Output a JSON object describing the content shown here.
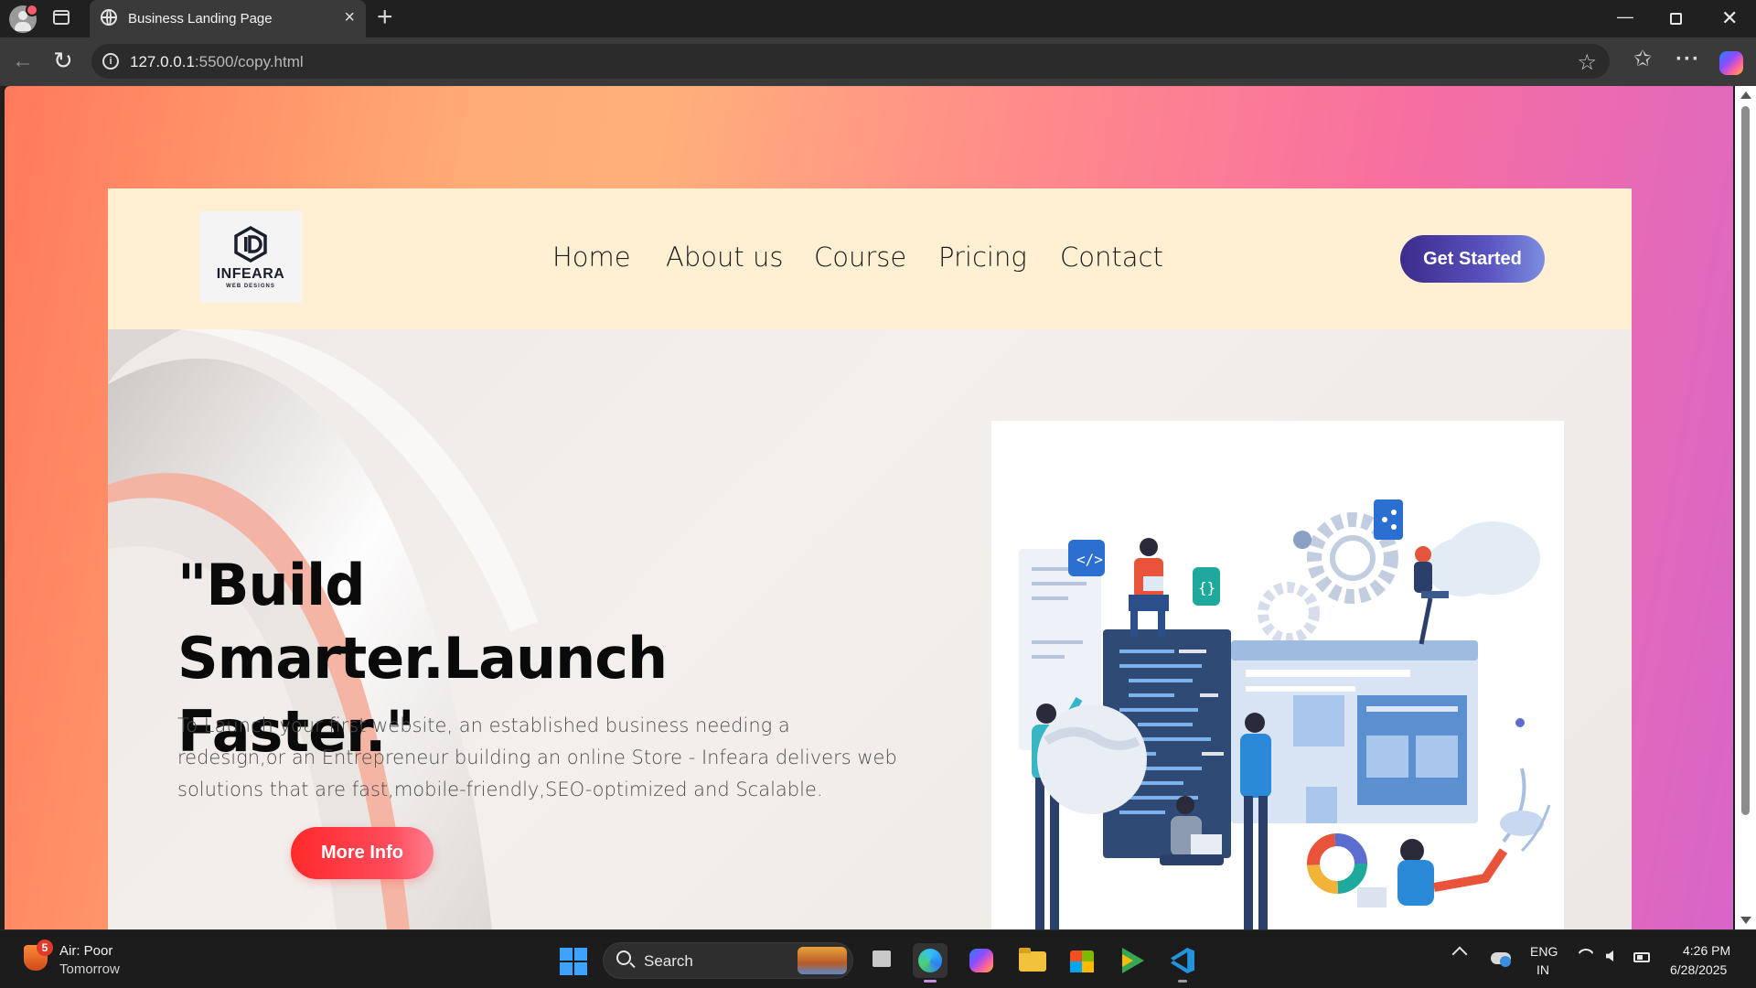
{
  "browser": {
    "tab_title": "Business Landing Page",
    "tab_close": "×",
    "new_tab": "+",
    "url_host": "127.0.0.1",
    "url_path": ":5500/copy.html",
    "back_glyph": "←",
    "reload_glyph": "↻",
    "star_glyph": "☆",
    "favorites_glyph": "✩",
    "more_glyph": "···",
    "minimize_glyph": "—",
    "close_glyph": "✕"
  },
  "site": {
    "logo_text": "INFEARA",
    "logo_sub": "WEB DESIGNS",
    "nav": [
      "Home",
      "About us",
      "Course",
      "Pricing",
      "Contact"
    ],
    "cta_label": "Get Started"
  },
  "hero": {
    "title": "\"Build Smarter.Launch Faster.\"",
    "description": "To Launch your first website, an established business needing a redesign,or an Entrepreneur building an online Store - Infeara delivers web solutions that are fast,mobile-friendly,SEO-optimized and Scalable.",
    "button_label": "More Info"
  },
  "taskbar": {
    "weather_badge": "5",
    "weather_title": "Air: Poor",
    "weather_sub": "Tomorrow",
    "search_label": "Search",
    "lang_line1": "ENG",
    "lang_line2": "IN",
    "time": "4:26 PM",
    "date": "6/28/2025"
  },
  "colors": {
    "header_bg": "#fff0d3",
    "cta_start": "#3c2c8c",
    "cta_end": "#7b8ee0",
    "more_info_start": "#ff2a2a",
    "more_info_end": "#ff7e8e",
    "page_gradient": [
      "#ff7a5c",
      "#ffab76",
      "#f76fa0",
      "#d765c8"
    ]
  }
}
